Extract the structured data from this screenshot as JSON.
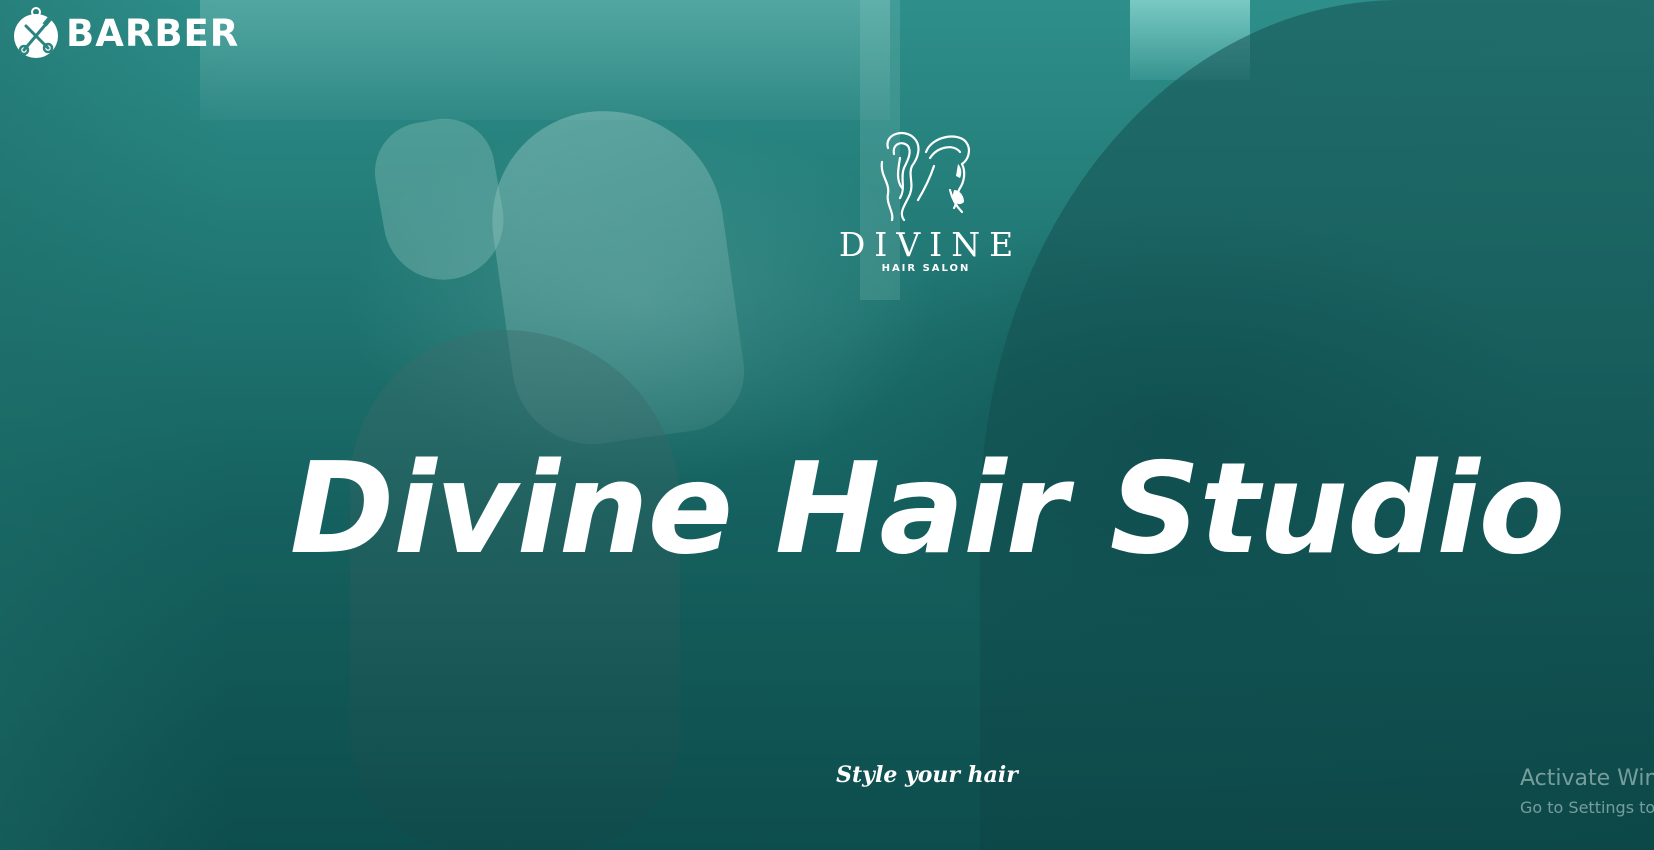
{
  "brand": {
    "icon": "scissors-comb-icon",
    "name": "BARBER"
  },
  "salon_logo": {
    "icon": "hair-silhouette-logo",
    "name": "DIVINE",
    "tagline": "HAIR SALON"
  },
  "hero": {
    "title": "Divine Hair Studio",
    "subtitle": "Style your hair"
  },
  "watermark": {
    "title": "Activate Win",
    "subtitle": "Go to Settings to"
  },
  "colors": {
    "overlay_top": "#2e8f8a",
    "overlay_bottom": "#0d4d4d",
    "text": "#ffffff"
  }
}
